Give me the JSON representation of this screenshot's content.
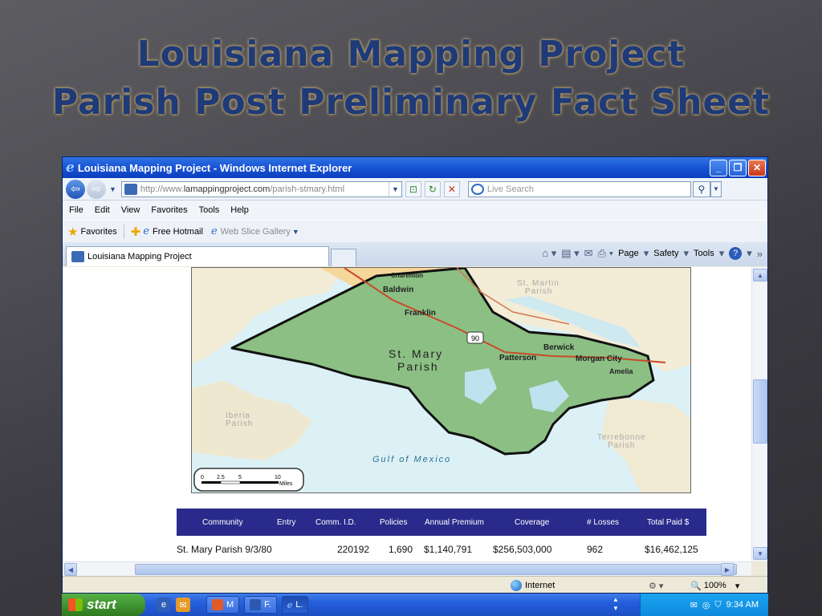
{
  "slide": {
    "title_line1": "Louisiana Mapping Project",
    "title_line2": "Parish Post Preliminary Fact Sheet"
  },
  "window": {
    "title": "Louisiana Mapping Project - Windows Internet Explorer",
    "address_prefix": "http://www.",
    "address_domain": "lamappingproject.com",
    "address_path": "/parish-stmary.html",
    "search_placeholder": "Live Search"
  },
  "menu": [
    "File",
    "Edit",
    "View",
    "Favorites",
    "Tools",
    "Help"
  ],
  "favorites_bar": {
    "favorites_label": "Favorites",
    "item1": "Free Hotmail",
    "item2": "Web Slice Gallery"
  },
  "tab": {
    "label": "Louisiana Mapping Project"
  },
  "command_bar": {
    "page": "Page",
    "safety": "Safety",
    "tools": "Tools"
  },
  "map": {
    "labels": {
      "charenton": "Charenton",
      "baldwin": "Baldwin",
      "franklin": "Franklin",
      "st_mary_1": "St. Mary",
      "st_mary_2": "Parish",
      "berwick": "Berwick",
      "patterson": "Patterson",
      "morgan_city": "Morgan City",
      "amelia": "Amelia",
      "st_martin_1": "St. Martin",
      "st_martin_2": "Parish",
      "iberia_1": "Iberia",
      "iberia_2": "Parish",
      "terrebonne_1": "Terrebonne",
      "terrebonne_2": "Parish",
      "gulf": "Gulf of Mexico",
      "highway": "90"
    },
    "scale": {
      "t0": "0",
      "t1": "2.5",
      "t2": "5",
      "t3": "10",
      "unit": "Miles"
    }
  },
  "table": {
    "headers": [
      "Community",
      "Entry",
      "Comm. I.D.",
      "Policies",
      "Annual Premium",
      "Coverage",
      "# Losses",
      "Total Paid $"
    ],
    "row": {
      "community_entry": "St. Mary Parish 9/3/80",
      "comm_id": "220192",
      "policies": "1,690",
      "annual_premium": "$1,140,791",
      "coverage": "$256,503,000",
      "losses": "962",
      "total_paid": "$16,462,125"
    }
  },
  "status": {
    "zone": "Internet",
    "zoom": "100%"
  },
  "taskbar": {
    "start": "start",
    "tasks": [
      "M",
      "F.",
      "L."
    ],
    "clock": "9:34 AM"
  }
}
